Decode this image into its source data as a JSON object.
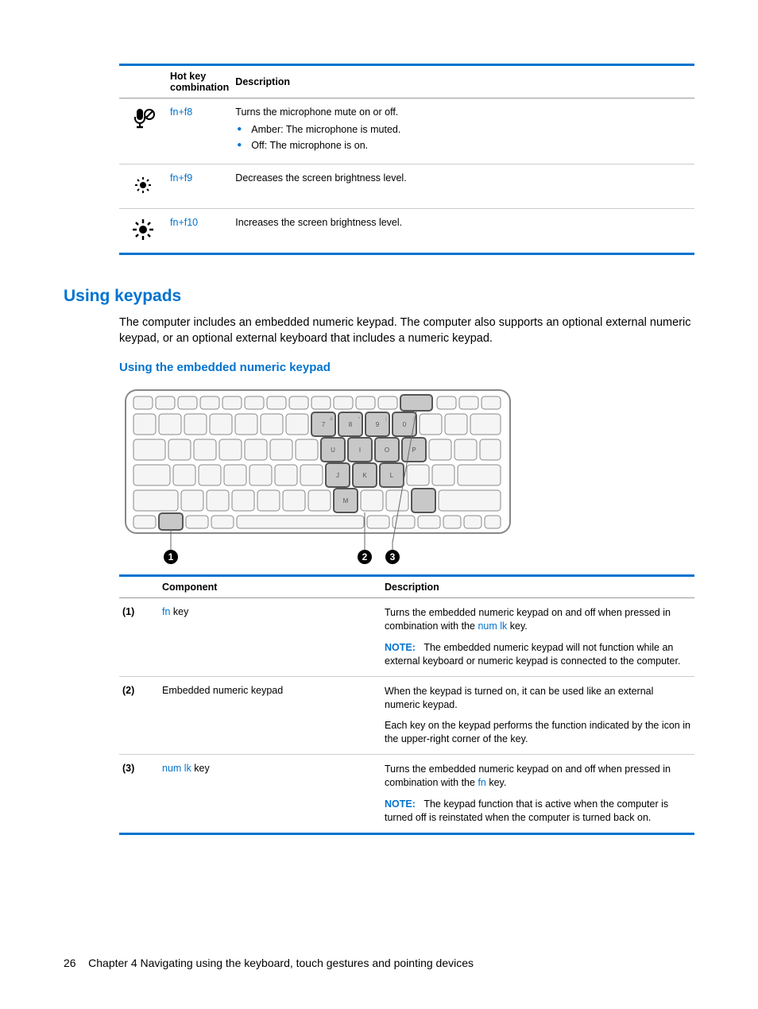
{
  "hotkey_table": {
    "headers": {
      "combo": "Hot key combination",
      "desc": "Description"
    },
    "rows": [
      {
        "icon": "mic-mute-icon",
        "combo_fn": "fn",
        "combo_plus": "+",
        "combo_key": "f8",
        "desc_main": "Turns the microphone mute on or off.",
        "bullets": [
          "Amber: The microphone is muted.",
          "Off: The microphone is on."
        ]
      },
      {
        "icon": "brightness-down-icon",
        "combo_fn": "fn",
        "combo_plus": "+",
        "combo_key": "f9",
        "desc_main": "Decreases the screen brightness level."
      },
      {
        "icon": "brightness-up-icon",
        "combo_fn": "fn",
        "combo_plus": "+",
        "combo_key": "f10",
        "desc_main": "Increases the screen brightness level."
      }
    ]
  },
  "section": {
    "heading": "Using keypads",
    "paragraph": "The computer includes an embedded numeric keypad. The computer also supports an optional external numeric keypad, or an optional external keyboard that includes a numeric keypad."
  },
  "subsection": {
    "heading": "Using the embedded numeric keypad"
  },
  "components_table": {
    "headers": {
      "component": "Component",
      "desc": "Description"
    },
    "rows": [
      {
        "num": "(1)",
        "comp_link": "fn",
        "comp_rest": " key",
        "desc_pre": "Turns the embedded numeric keypad on and off when pressed in combination with the ",
        "desc_link": "num lk",
        "desc_post": " key.",
        "note_label": "NOTE:",
        "note_text": "The embedded numeric keypad will not function while an external keyboard or numeric keypad is connected to the computer."
      },
      {
        "num": "(2)",
        "comp_plain": "Embedded numeric keypad",
        "desc1": "When the keypad is turned on, it can be used like an external numeric keypad.",
        "desc2": "Each key on the keypad performs the function indicated by the icon in the upper-right corner of the key."
      },
      {
        "num": "(3)",
        "comp_link": "num lk",
        "comp_rest": " key",
        "desc_pre": "Turns the embedded numeric keypad on and off when pressed in combination with the ",
        "desc_link": "fn",
        "desc_post": " key.",
        "note_label": "NOTE:",
        "note_text": "The keypad function that is active when the computer is turned off is reinstated when the computer is turned back on."
      }
    ]
  },
  "footer": {
    "page": "26",
    "chapter": "Chapter 4   Navigating using the keyboard, touch gestures and pointing devices"
  }
}
